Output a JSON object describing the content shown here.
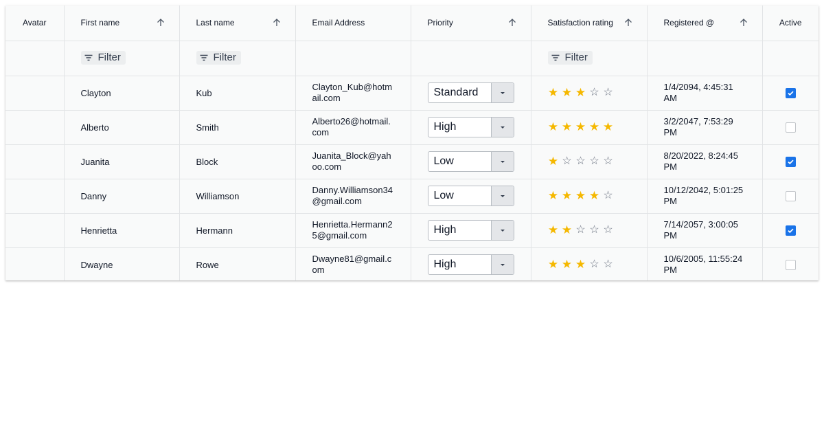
{
  "grid": {
    "columns": {
      "avatar": "Avatar",
      "first_name": "First name",
      "last_name": "Last name",
      "email": "Email Address",
      "priority": "Priority",
      "satisfaction": "Satisfaction rating",
      "registered": "Registered @",
      "active": "Active"
    },
    "filters": {
      "first_name": "Filter",
      "last_name": "Filter",
      "satisfaction": "Filter"
    },
    "icons": {
      "sort": "arrow-up-icon",
      "filter": "filter-lines-icon",
      "dropdown": "caret-down-icon",
      "rating_full": "star-filled-icon",
      "rating_empty": "star-outline-icon",
      "checkbox": "check-icon"
    },
    "colors": {
      "accent": "#1a73e8",
      "star": "#f5b800"
    },
    "rows": [
      {
        "first_name": "Clayton",
        "last_name": "Kub",
        "email": "Clayton_Kub@hotmail.com",
        "priority": "Standard",
        "rating": 3,
        "registered": "1/4/2094, 4:45:31 AM",
        "active": true
      },
      {
        "first_name": "Alberto",
        "last_name": "Smith",
        "email": "Alberto26@hotmail.com",
        "priority": "High",
        "rating": 5,
        "registered": "3/2/2047, 7:53:29 PM",
        "active": false
      },
      {
        "first_name": "Juanita",
        "last_name": "Block",
        "email": "Juanita_Block@yahoo.com",
        "priority": "Low",
        "rating": 1,
        "registered": "8/20/2022, 8:24:45 PM",
        "active": true
      },
      {
        "first_name": "Danny",
        "last_name": "Williamson",
        "email": "Danny.Williamson34@gmail.com",
        "priority": "Low",
        "rating": 4,
        "registered": "10/12/2042, 5:01:25 PM",
        "active": false
      },
      {
        "first_name": "Henrietta",
        "last_name": "Hermann",
        "email": "Henrietta.Hermann25@gmail.com",
        "priority": "High",
        "rating": 2,
        "registered": "7/14/2057, 3:00:05 PM",
        "active": true
      },
      {
        "first_name": "Dwayne",
        "last_name": "Rowe",
        "email": "Dwayne81@gmail.com",
        "priority": "High",
        "rating": 3,
        "registered": "10/6/2005, 11:55:24 PM",
        "active": false
      }
    ]
  }
}
